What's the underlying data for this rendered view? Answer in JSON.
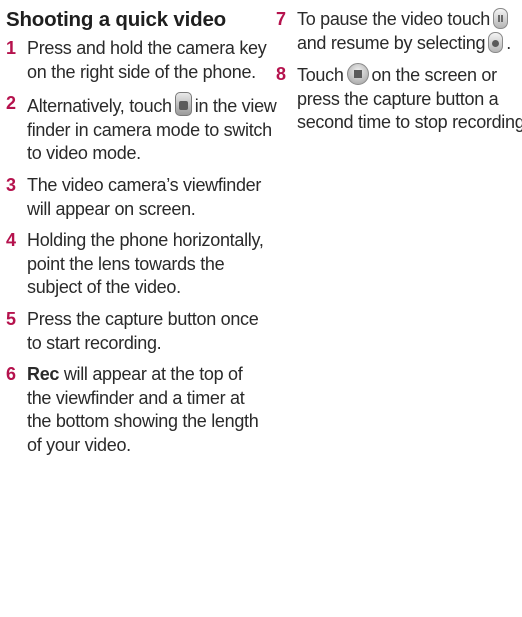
{
  "heading": "Shooting a quick video",
  "steps_left": [
    {
      "num": "1",
      "text": "Press and hold the camera key on the right side of the phone."
    },
    {
      "num": "2",
      "before": "Alternatively, touch",
      "icon": "camera-mode-icon",
      "after": "in the view finder in camera mode to switch to video mode."
    },
    {
      "num": "3",
      "text": "The video camera’s viewfinder will appear on screen."
    },
    {
      "num": "4",
      "text": "Holding the phone horizontally, point the lens towards the subject of the video."
    },
    {
      "num": "5",
      "text": "Press the capture button once to start recording."
    },
    {
      "num": "6",
      "bold": "Rec",
      "after": "will appear at the top of the viewfinder and a timer at the bottom showing the length of your video."
    }
  ],
  "steps_right": [
    {
      "num": "7",
      "part1": "To pause the video touch",
      "icon1": "pause-icon",
      "part2": "and resume by selecting",
      "icon2": "record-icon",
      "part3": "."
    },
    {
      "num": "8",
      "part1": "Touch",
      "icon1": "stop-icon",
      "part2": "on the screen or press the capture button a second time to stop recording."
    }
  ]
}
